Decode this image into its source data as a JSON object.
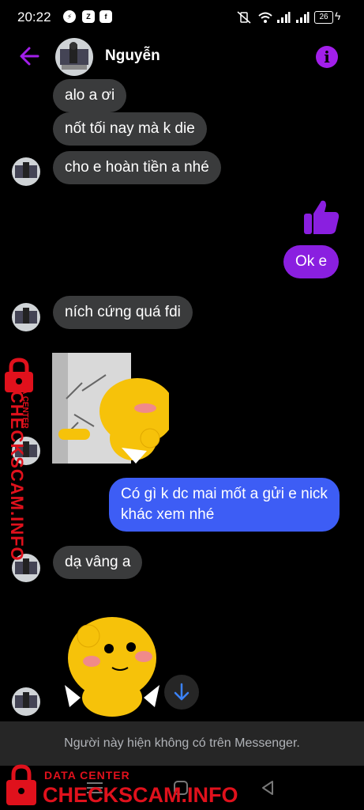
{
  "status_bar": {
    "time": "20:22",
    "battery": "26"
  },
  "header": {
    "contact_name": "Nguyễn"
  },
  "messages": [
    {
      "dir": "in",
      "text": "alo a ơi"
    },
    {
      "dir": "in",
      "text": "nốt tối nay mà k die"
    },
    {
      "dir": "in",
      "text": "cho e hoàn tiền a nhé"
    },
    {
      "dir": "out",
      "kind": "like",
      "icon": "thumbs-up-icon"
    },
    {
      "dir": "out",
      "text": "Ok e"
    },
    {
      "dir": "in",
      "text": "ních cứng quá fdi"
    },
    {
      "dir": "in",
      "kind": "sticker",
      "icon": "sticker-duck-wall-icon"
    },
    {
      "dir": "out",
      "text": "Có gì k dc mai mốt a gửi e nick khác xem nhé"
    },
    {
      "dir": "in",
      "text": "dạ vâng a"
    },
    {
      "dir": "in",
      "kind": "sticker",
      "icon": "sticker-duck-shy-icon"
    }
  ],
  "notice": "Người này hiện không có trên Messenger.",
  "watermark": {
    "small": "DATA CENTER",
    "large": "CHECKSCAM.INFO",
    "side_small": "DATA CENTER",
    "side_large": "CHECKSCAM.INFO"
  },
  "colors": {
    "accent": "#a21fea",
    "outgoing_purple": "#8a1fe0",
    "outgoing_blue": "#3d5df5",
    "incoming": "#3a3b3c",
    "watermark": "#e0111c"
  }
}
